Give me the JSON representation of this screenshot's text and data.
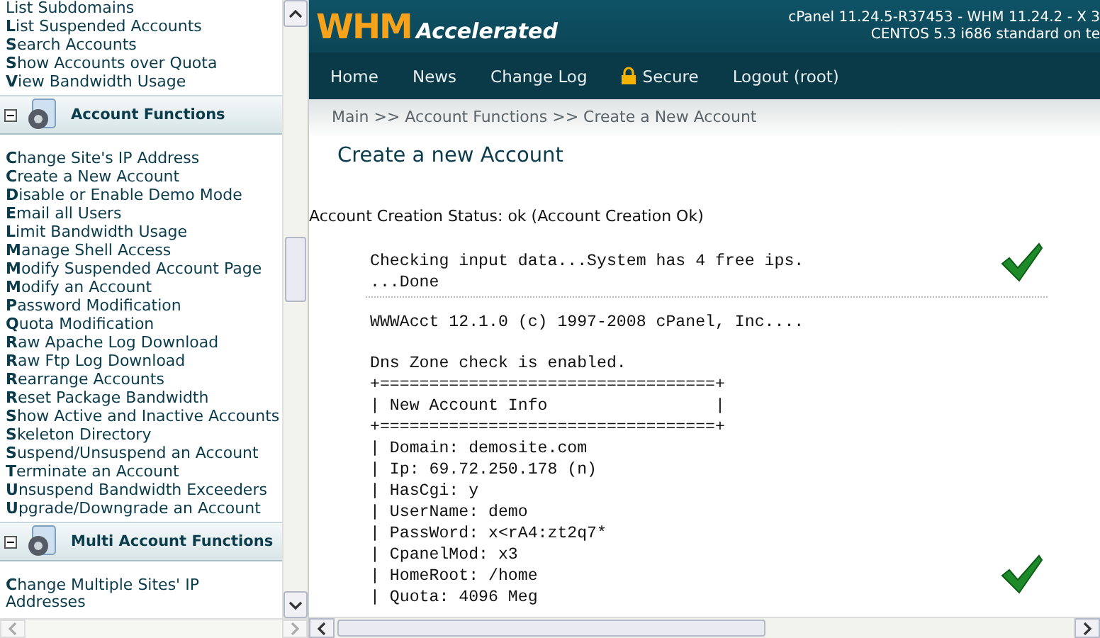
{
  "sidebar": {
    "sections": [
      {
        "items": [
          "List Subdomains",
          "**L**ist Suspended Accounts",
          "**S**earch Accounts",
          "**S**how Accounts over Quota",
          "**V**iew Bandwidth Usage"
        ]
      },
      {
        "title": "Account Functions",
        "expanded": true,
        "items": [
          "**C**hange Site's IP Address",
          "**C**reate a New Account",
          "**D**isable or Enable Demo Mode",
          "**E**mail all Users",
          "**L**imit Bandwidth Usage",
          "**M**anage Shell Access",
          "**M**odify Suspended Account Page",
          "**M**odify an Account",
          "**P**assword Modification",
          "**Q**uota Modification",
          "**R**aw Apache Log Download",
          "**R**aw Ftp Log Download",
          "**R**earrange Accounts",
          "**R**eset Package Bandwidth",
          "**S**how Active and Inactive Accounts",
          "**S**keleton Directory",
          "**S**uspend/Unsuspend an Account",
          "**T**erminate an Account",
          "**U**nsuspend Bandwidth Exceeders",
          "**U**pgrade/Downgrade an Account"
        ]
      },
      {
        "title": "Multi Account Functions",
        "expanded": true,
        "items": [
          "**C**hange Multiple Sites' IP Addresses"
        ]
      }
    ]
  },
  "header": {
    "logo": {
      "brand": "WHM",
      "product": "Accelerated"
    },
    "version_lines": [
      "cPanel 11.24.5-R37453 - WHM 11.24.2 - X 3",
      "CENTOS 5.3 i686 standard on te"
    ]
  },
  "nav": [
    {
      "label": "Home",
      "kind": "link"
    },
    {
      "label": "News",
      "kind": "link"
    },
    {
      "label": "Change Log",
      "kind": "link"
    },
    {
      "label": "Secure",
      "kind": "secure"
    },
    {
      "label": "Logout (root)",
      "kind": "link"
    }
  ],
  "breadcrumb": "Main >> Account Functions >> Create a New Account",
  "title": "Create a new Account",
  "status": "Account Creation Status: ok (Account Creation Ok)",
  "output_blocks": [
    {
      "lines": [
        {
          "text": "Checking input data...System has 4 free ips.",
          "kind": "checked"
        },
        {
          "text": "...Done",
          "kind": "plain"
        }
      ]
    },
    {
      "lines": [
        {
          "text": "WWWAcct 12.1.0 (c) 1997-2008 cPanel, Inc....",
          "kind": "plain"
        },
        {
          "text": "Dns Zone check is enabled.",
          "kind": "after_blank"
        },
        {
          "text": "+==================================+",
          "kind": "plain"
        },
        {
          "text": "| New Account Info                 |",
          "kind": "plain"
        },
        {
          "text": "+==================================+",
          "kind": "plain"
        },
        {
          "text": "| Domain: demosite.com",
          "kind": "plain"
        },
        {
          "text": "| Ip: 69.72.250.178 (n)",
          "kind": "plain"
        },
        {
          "text": "| HasCgi: y",
          "kind": "plain"
        },
        {
          "text": "| UserName: demo",
          "kind": "plain"
        },
        {
          "text": "| PassWord: x<rA4:zt2q7*",
          "kind": "plain"
        },
        {
          "text": "| CpanelMod: x3",
          "kind": "plain"
        },
        {
          "text": "| HomeRoot: /home",
          "kind": "checked"
        },
        {
          "text": "| Quota: 4096 Meg",
          "kind": "plain"
        }
      ]
    }
  ]
}
